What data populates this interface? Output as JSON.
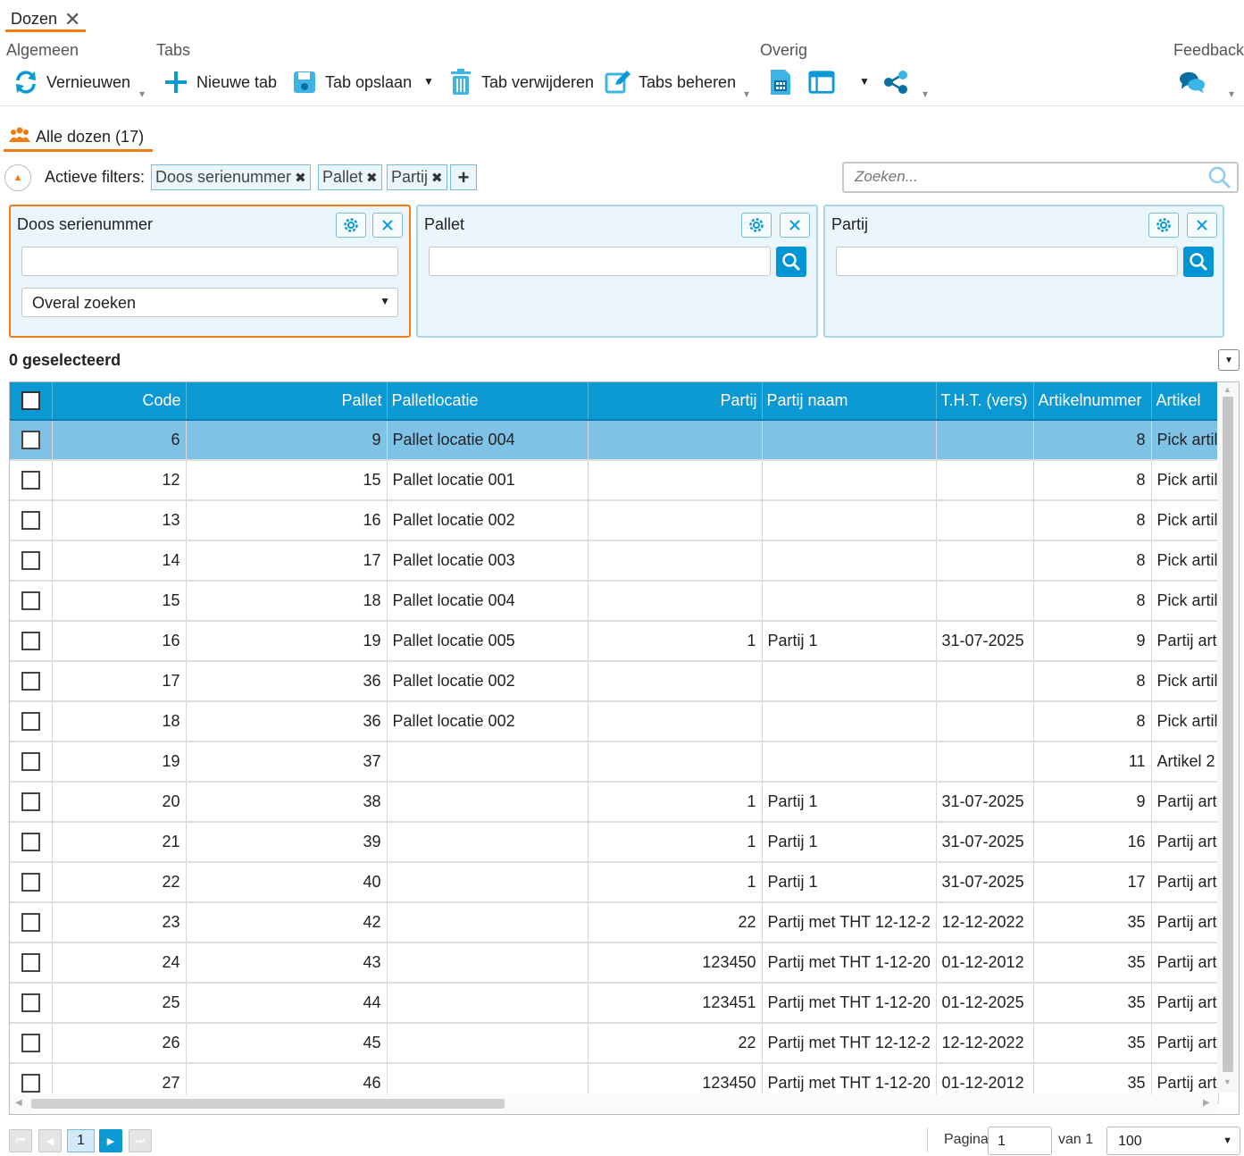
{
  "page_tab": {
    "label": "Dozen",
    "close": "✕"
  },
  "ribbon": {
    "groups": {
      "algemeen": "Algemeen",
      "tabs": "Tabs",
      "overig": "Overig",
      "feedback": "Feedback"
    },
    "buttons": {
      "vernieuwen": "Vernieuwen",
      "nieuwe_tab": "Nieuwe tab",
      "tab_opslaan": "Tab opslaan",
      "tab_verwijderen": "Tab verwijderen",
      "tabs_beheren": "Tabs beheren"
    },
    "icons": [
      "refresh-icon",
      "plus-icon",
      "save-icon",
      "trash-icon",
      "edit-icon",
      "calculator-icon",
      "window-icon",
      "share-icon",
      "chat-icon"
    ],
    "colors": {
      "icon": "#0b99d3",
      "accent": "#f07c12"
    }
  },
  "view_tab": {
    "label": "Alle dozen (17)"
  },
  "filters": {
    "label": "Actieve filters:",
    "chips": [
      "Doos serienummer",
      "Pallet",
      "Partij"
    ],
    "add": "+",
    "search_placeholder": "Zoeken..."
  },
  "panels": [
    {
      "title": "Doos serienummer",
      "value": "",
      "mode": "Overal zoeken"
    },
    {
      "title": "Pallet",
      "value": ""
    },
    {
      "title": "Partij",
      "value": ""
    }
  ],
  "selection": {
    "count_label": "0 geselecteerd"
  },
  "grid": {
    "columns": [
      "Code",
      "Pallet",
      "Palletlocatie",
      "Partij",
      "Partij naam",
      "T.H.T. (vers)",
      "Artikelnummer",
      "Artikel"
    ],
    "rows": [
      [
        "6",
        "9",
        "Pallet locatie 004",
        "",
        "",
        "",
        "8",
        "Pick artil"
      ],
      [
        "12",
        "15",
        "Pallet locatie 001",
        "",
        "",
        "",
        "8",
        "Pick artil"
      ],
      [
        "13",
        "16",
        "Pallet locatie 002",
        "",
        "",
        "",
        "8",
        "Pick artil"
      ],
      [
        "14",
        "17",
        "Pallet locatie 003",
        "",
        "",
        "",
        "8",
        "Pick artil"
      ],
      [
        "15",
        "18",
        "Pallet locatie 004",
        "",
        "",
        "",
        "8",
        "Pick artil"
      ],
      [
        "16",
        "19",
        "Pallet locatie 005",
        "1",
        "Partij 1",
        "31-07-2025",
        "9",
        "Partij art"
      ],
      [
        "17",
        "36",
        "Pallet locatie 002",
        "",
        "",
        "",
        "8",
        "Pick artil"
      ],
      [
        "18",
        "36",
        "Pallet locatie 002",
        "",
        "",
        "",
        "8",
        "Pick artil"
      ],
      [
        "19",
        "37",
        "",
        "",
        "",
        "",
        "11",
        "Artikel 2"
      ],
      [
        "20",
        "38",
        "",
        "1",
        "Partij 1",
        "31-07-2025",
        "9",
        "Partij art"
      ],
      [
        "21",
        "39",
        "",
        "1",
        "Partij 1",
        "31-07-2025",
        "16",
        "Partij art"
      ],
      [
        "22",
        "40",
        "",
        "1",
        "Partij 1",
        "31-07-2025",
        "17",
        "Partij art"
      ],
      [
        "23",
        "42",
        "",
        "22",
        "Partij met THT 12-12-2",
        "12-12-2022",
        "35",
        "Partij art"
      ],
      [
        "24",
        "43",
        "",
        "123450",
        "Partij met THT 1-12-20",
        "01-12-2012",
        "35",
        "Partij art"
      ],
      [
        "25",
        "44",
        "",
        "123451",
        "Partij met THT 1-12-20",
        "01-12-2025",
        "35",
        "Partij art"
      ],
      [
        "26",
        "45",
        "",
        "22",
        "Partij met THT 12-12-2",
        "12-12-2022",
        "35",
        "Partij art"
      ],
      [
        "27",
        "46",
        "",
        "123450",
        "Partij met THT 1-12-20",
        "01-12-2012",
        "35",
        "Partij art"
      ]
    ],
    "selected_row": 0
  },
  "pager": {
    "current_page": "1",
    "page_label": "Pagina",
    "page_input": "1",
    "of_label": "van 1",
    "page_size": "100"
  }
}
